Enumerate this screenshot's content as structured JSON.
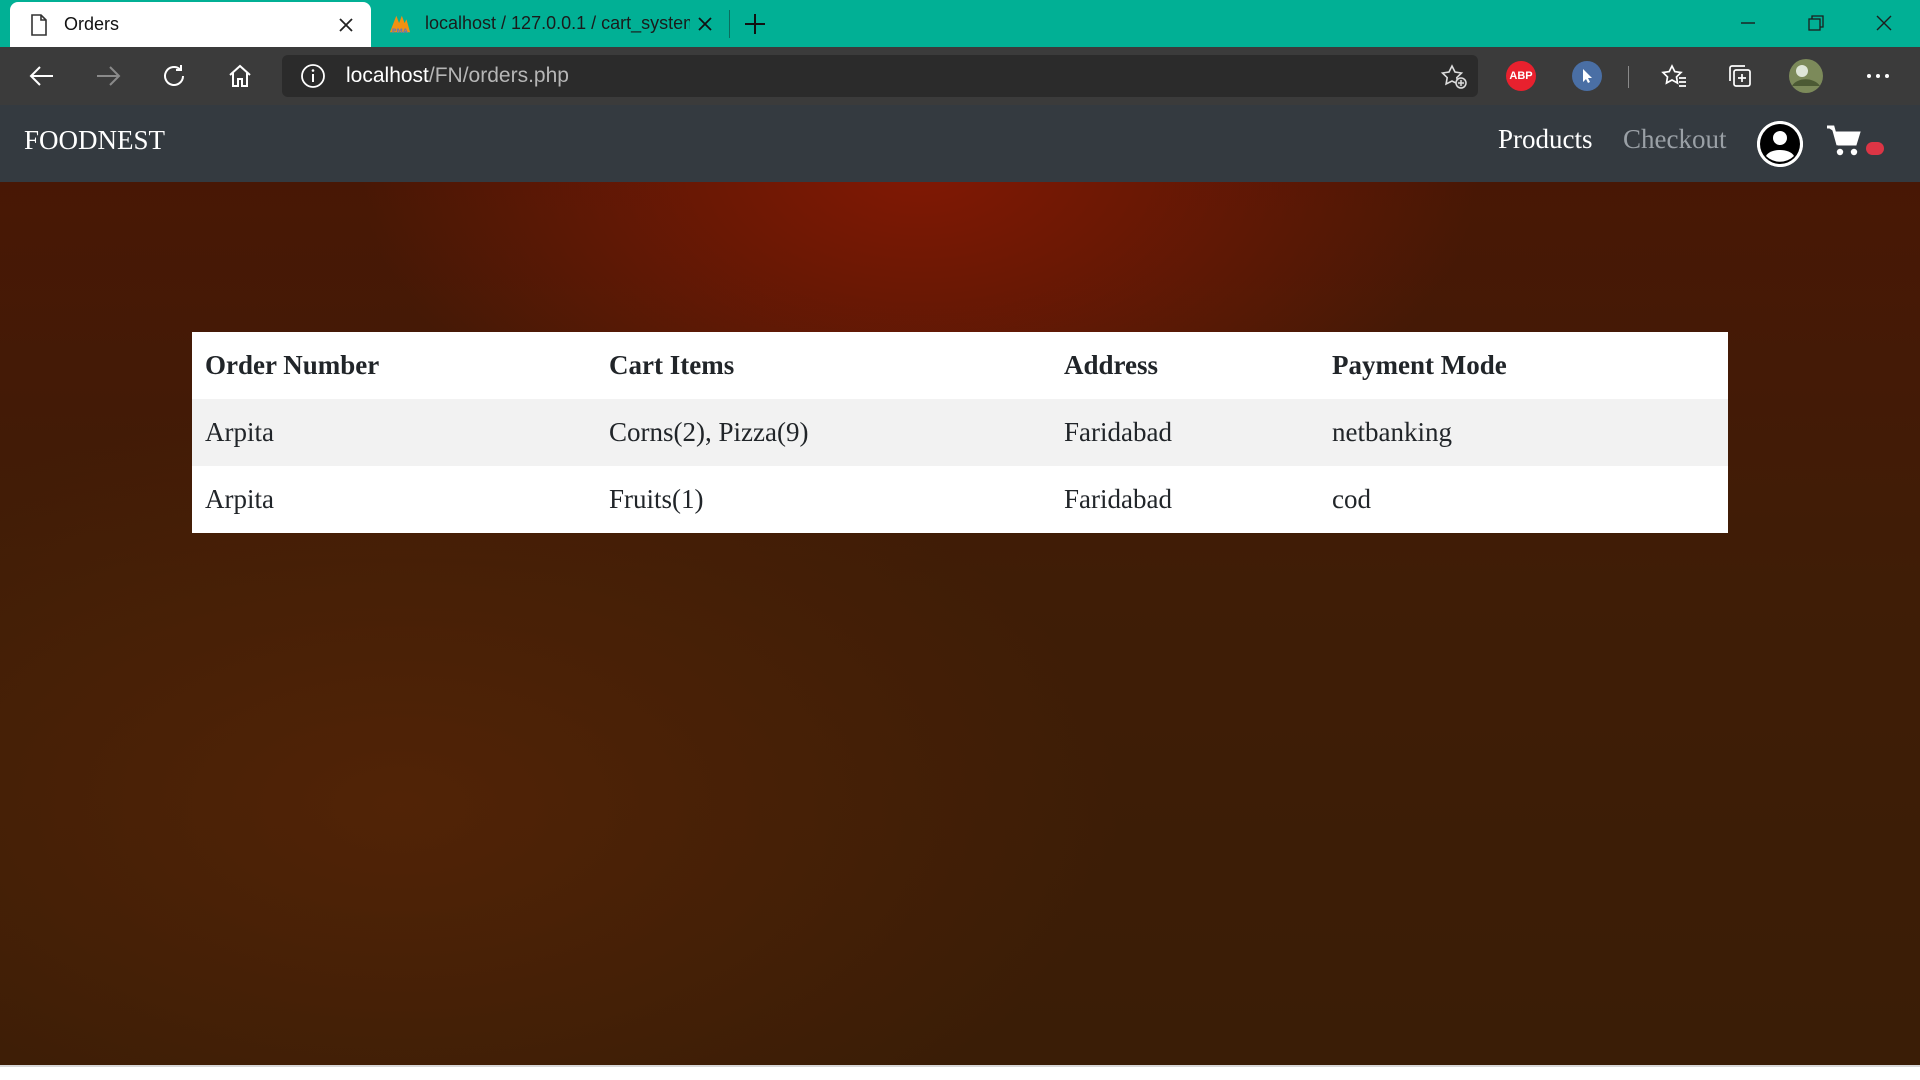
{
  "browser": {
    "tabs": [
      {
        "title": "Orders",
        "icon": "page-icon"
      },
      {
        "title": "localhost / 127.0.0.1 / cart_system",
        "icon": "phpmyadmin-icon"
      }
    ],
    "address": {
      "host": "localhost",
      "path": "/FN/orders.php"
    },
    "extensions": [
      {
        "name": "adblock-plus",
        "label": "ABP",
        "color": "#e8212e"
      },
      {
        "name": "cursor-extension",
        "color": "#4a6fa5"
      }
    ],
    "colors": {
      "tabbar": "#01b095",
      "toolbar": "#3b3b3b"
    }
  },
  "navbar": {
    "brand": "FOODNEST",
    "links": {
      "products": "Products",
      "checkout": "Checkout"
    },
    "cart_badge_color": "#dc3545"
  },
  "orders": {
    "headers": [
      "Order Number",
      "Cart Items",
      "Address",
      "Payment Mode"
    ],
    "rows": [
      [
        "Arpita",
        "Corns(2), Pizza(9)",
        "Faridabad",
        "netbanking"
      ],
      [
        "Arpita",
        "Fruits(1)",
        "Faridabad",
        "cod"
      ]
    ]
  }
}
